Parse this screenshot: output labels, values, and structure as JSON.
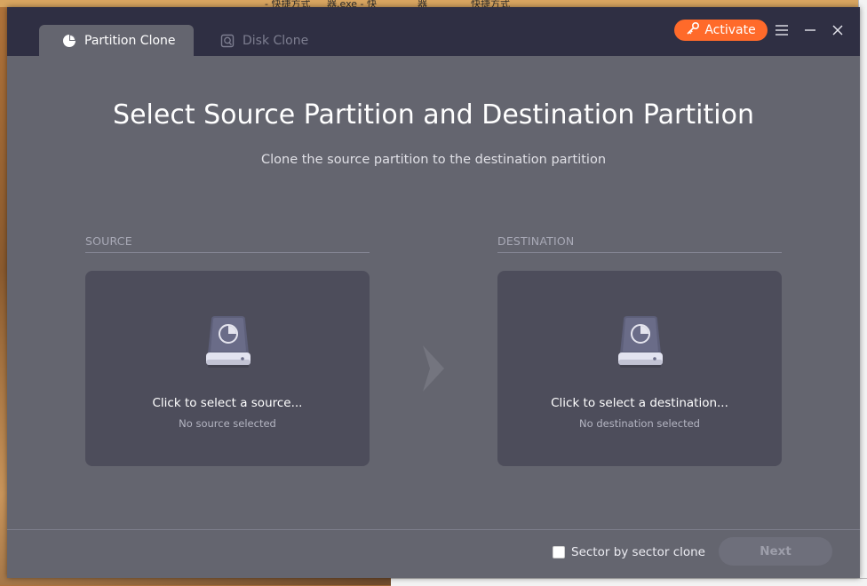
{
  "tabs": [
    {
      "label": "Partition Clone",
      "icon": "pie-chart-icon",
      "active": true
    },
    {
      "label": "Disk Clone",
      "icon": "disk-icon",
      "active": false
    }
  ],
  "header": {
    "activate_label": "Activate",
    "activate_icon": "key-icon",
    "accent_color": "#ff6a2a"
  },
  "main": {
    "title": "Select Source Partition and Destination Partition",
    "subtitle": "Clone the source partition to the destination partition"
  },
  "source": {
    "section_label": "SOURCE",
    "card_title": "Click to select a source...",
    "card_status": "No source selected"
  },
  "destination": {
    "section_label": "DESTINATION",
    "card_title": "Click to select a destination...",
    "card_status": "No destination selected"
  },
  "footer": {
    "sector_clone_label": "Sector by sector clone",
    "sector_clone_checked": false,
    "next_label": "Next"
  },
  "desktop": {
    "taskbar_items": [
      "- 快捷方式",
      "器.exe - 快",
      "器",
      "快捷方式"
    ]
  }
}
